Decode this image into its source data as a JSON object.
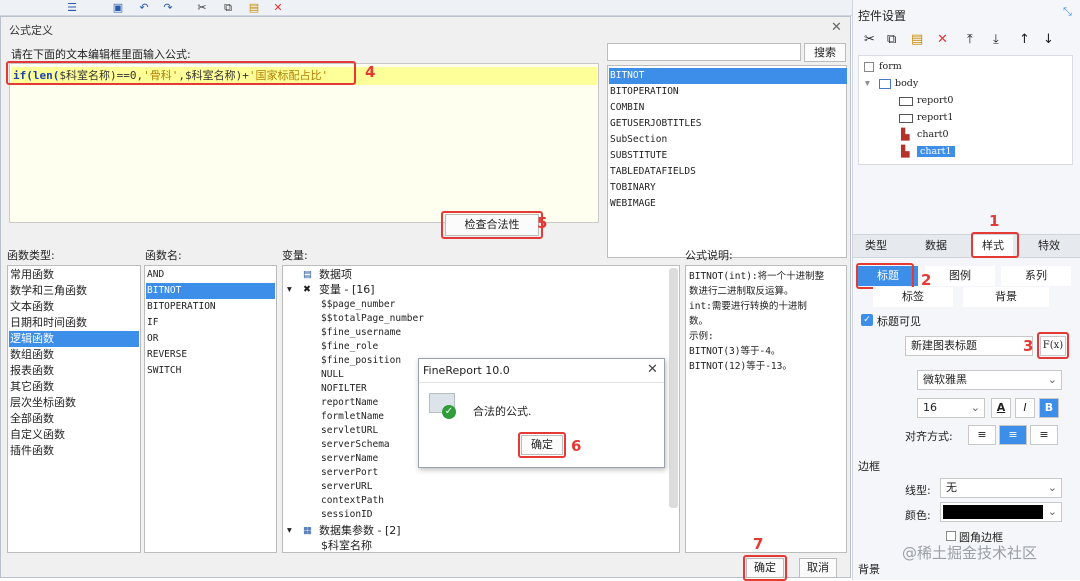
{
  "dialog": {
    "title": "公式定义",
    "instruction": "请在下面的文本编辑框里面输入公式:",
    "formula": {
      "kw_if": "if(",
      "kw_len": "len(",
      "var1": "$科室名称",
      "mid1": ")==0,",
      "str1": "'骨科'",
      "mid2": ",",
      "var2": "$科室名称",
      "mid3": ")+",
      "str2": "'国家标配占比'"
    },
    "search_placeholder": "",
    "search_label": "搜索",
    "function_list": [
      "BITNOT",
      "BITOPERATION",
      "COMBIN",
      "GETUSERJOBTITLES",
      "SubSection",
      "SUBSTITUTE",
      "TABLEDATAFIELDS",
      "TOBINARY",
      "WEBIMAGE"
    ],
    "check_label": "检查合法性",
    "headers": {
      "types": "函数类型:",
      "names": "函数名:",
      "vars": "变量:",
      "desc": "公式说明:"
    },
    "types": [
      "常用函数",
      "数学和三角函数",
      "文本函数",
      "日期和时间函数",
      "逻辑函数",
      "数组函数",
      "报表函数",
      "其它函数",
      "层次坐标函数",
      "全部函数",
      "自定义函数",
      "插件函数"
    ],
    "names": [
      "AND",
      "BITNOT",
      "BITOPERATION",
      "IF",
      "OR",
      "REVERSE",
      "SWITCH"
    ],
    "vars": {
      "root": "数据项",
      "group": "变量 - [16]",
      "items": [
        "$$page_number",
        "$$totalPage_number",
        "$fine_username",
        "$fine_role",
        "$fine_position",
        "NULL",
        "NOFILTER",
        "reportName",
        "formletName",
        "servletURL",
        "serverSchema",
        "serverName",
        "serverPort",
        "serverURL",
        "contextPath",
        "sessionID"
      ],
      "params_group": "数据集参数 - [2]",
      "params": [
        "$科室名称"
      ]
    },
    "description": [
      "BITNOT(int):将一个十进制整",
      "数进行二进制取反运算。",
      "int:需要进行转换的十进制",
      "数。",
      "示例:",
      "BITNOT(3)等于-4。",
      "BITNOT(12)等于-13。"
    ],
    "ok_label": "确定",
    "cancel_label": "取消"
  },
  "popup": {
    "title": "FineReport 10.0",
    "message": "合法的公式.",
    "ok_label": "确定"
  },
  "steps": [
    "1",
    "2",
    "3",
    "4",
    "5",
    "6",
    "7"
  ],
  "right_panel": {
    "title": "控件设置",
    "tree": {
      "form": "form",
      "body": "body",
      "children": [
        "report0",
        "report1",
        "chart0",
        "chart1"
      ]
    },
    "tabs": [
      "类型",
      "数据",
      "样式",
      "特效"
    ],
    "subtabs_row1": [
      "标题",
      "图例",
      "系列"
    ],
    "subtabs_row2": [
      "标签",
      "背景"
    ],
    "title_visible_label": "标题可见",
    "title_value": "新建图表标题",
    "formula_btn": "F(x)",
    "font_family": "微软雅黑",
    "font_size": "16",
    "align_label": "对齐方式:",
    "border_section": "边框",
    "line_type_label": "线型:",
    "line_type_value": "无",
    "color_label": "颜色:",
    "rounded_label": "圆角边框",
    "bg_section": "背景"
  },
  "watermark": "@稀土掘金技术社区",
  "colors": {
    "selection": "#3d8ee8",
    "highlight": "#e53935",
    "formula_line": "#ffff99"
  }
}
